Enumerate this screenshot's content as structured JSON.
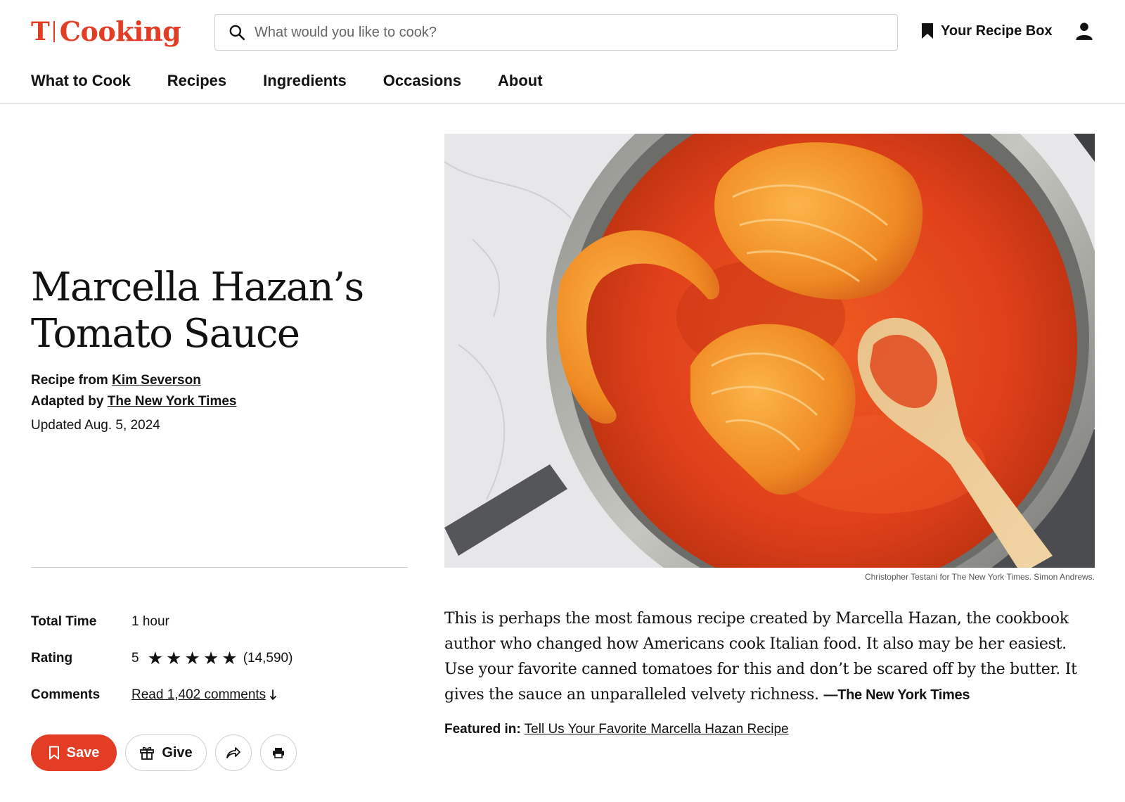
{
  "header": {
    "logo_mark": "T",
    "logo_text": "Cooking",
    "search_placeholder": "What would you like to cook?",
    "recipe_box_label": "Your Recipe Box"
  },
  "nav": {
    "items": [
      {
        "label": "What to Cook"
      },
      {
        "label": "Recipes"
      },
      {
        "label": "Ingredients"
      },
      {
        "label": "Occasions"
      },
      {
        "label": "About"
      }
    ]
  },
  "recipe": {
    "title_line1": "Marcella Hazan’s",
    "title_line2": "Tomato Sauce",
    "recipe_from_label": "Recipe from",
    "author": "Kim Severson",
    "adapted_by_label": "Adapted by",
    "adapted_by": "The New York Times",
    "updated": "Updated Aug. 5, 2024"
  },
  "stats": {
    "total_time_label": "Total Time",
    "total_time_value": "1 hour",
    "rating_label": "Rating",
    "rating_value": "5",
    "rating_stars": 5,
    "rating_count": "(14,590)",
    "comments_label": "Comments",
    "comments_link": "Read 1,402 comments"
  },
  "actions": {
    "save_label": "Save",
    "give_label": "Give"
  },
  "image": {
    "credit": "Christopher Testani for The New York Times. Simon Andrews."
  },
  "description": {
    "text": "This is perhaps the most famous recipe created by Marcella Hazan, the cookbook author who changed how Americans cook Italian food. It also may be her easiest. Use your favorite canned tomatoes for this and don’t be scared off by the butter. It gives the sauce an unparalleled velvety richness.",
    "source": "—The New York Times",
    "featured_label": "Featured in:",
    "featured_link": "Tell Us Your Favorite Marcella Hazan Recipe"
  },
  "colors": {
    "brand_red": "#e33d26",
    "text": "#121212",
    "sauce": "#e4421a"
  }
}
